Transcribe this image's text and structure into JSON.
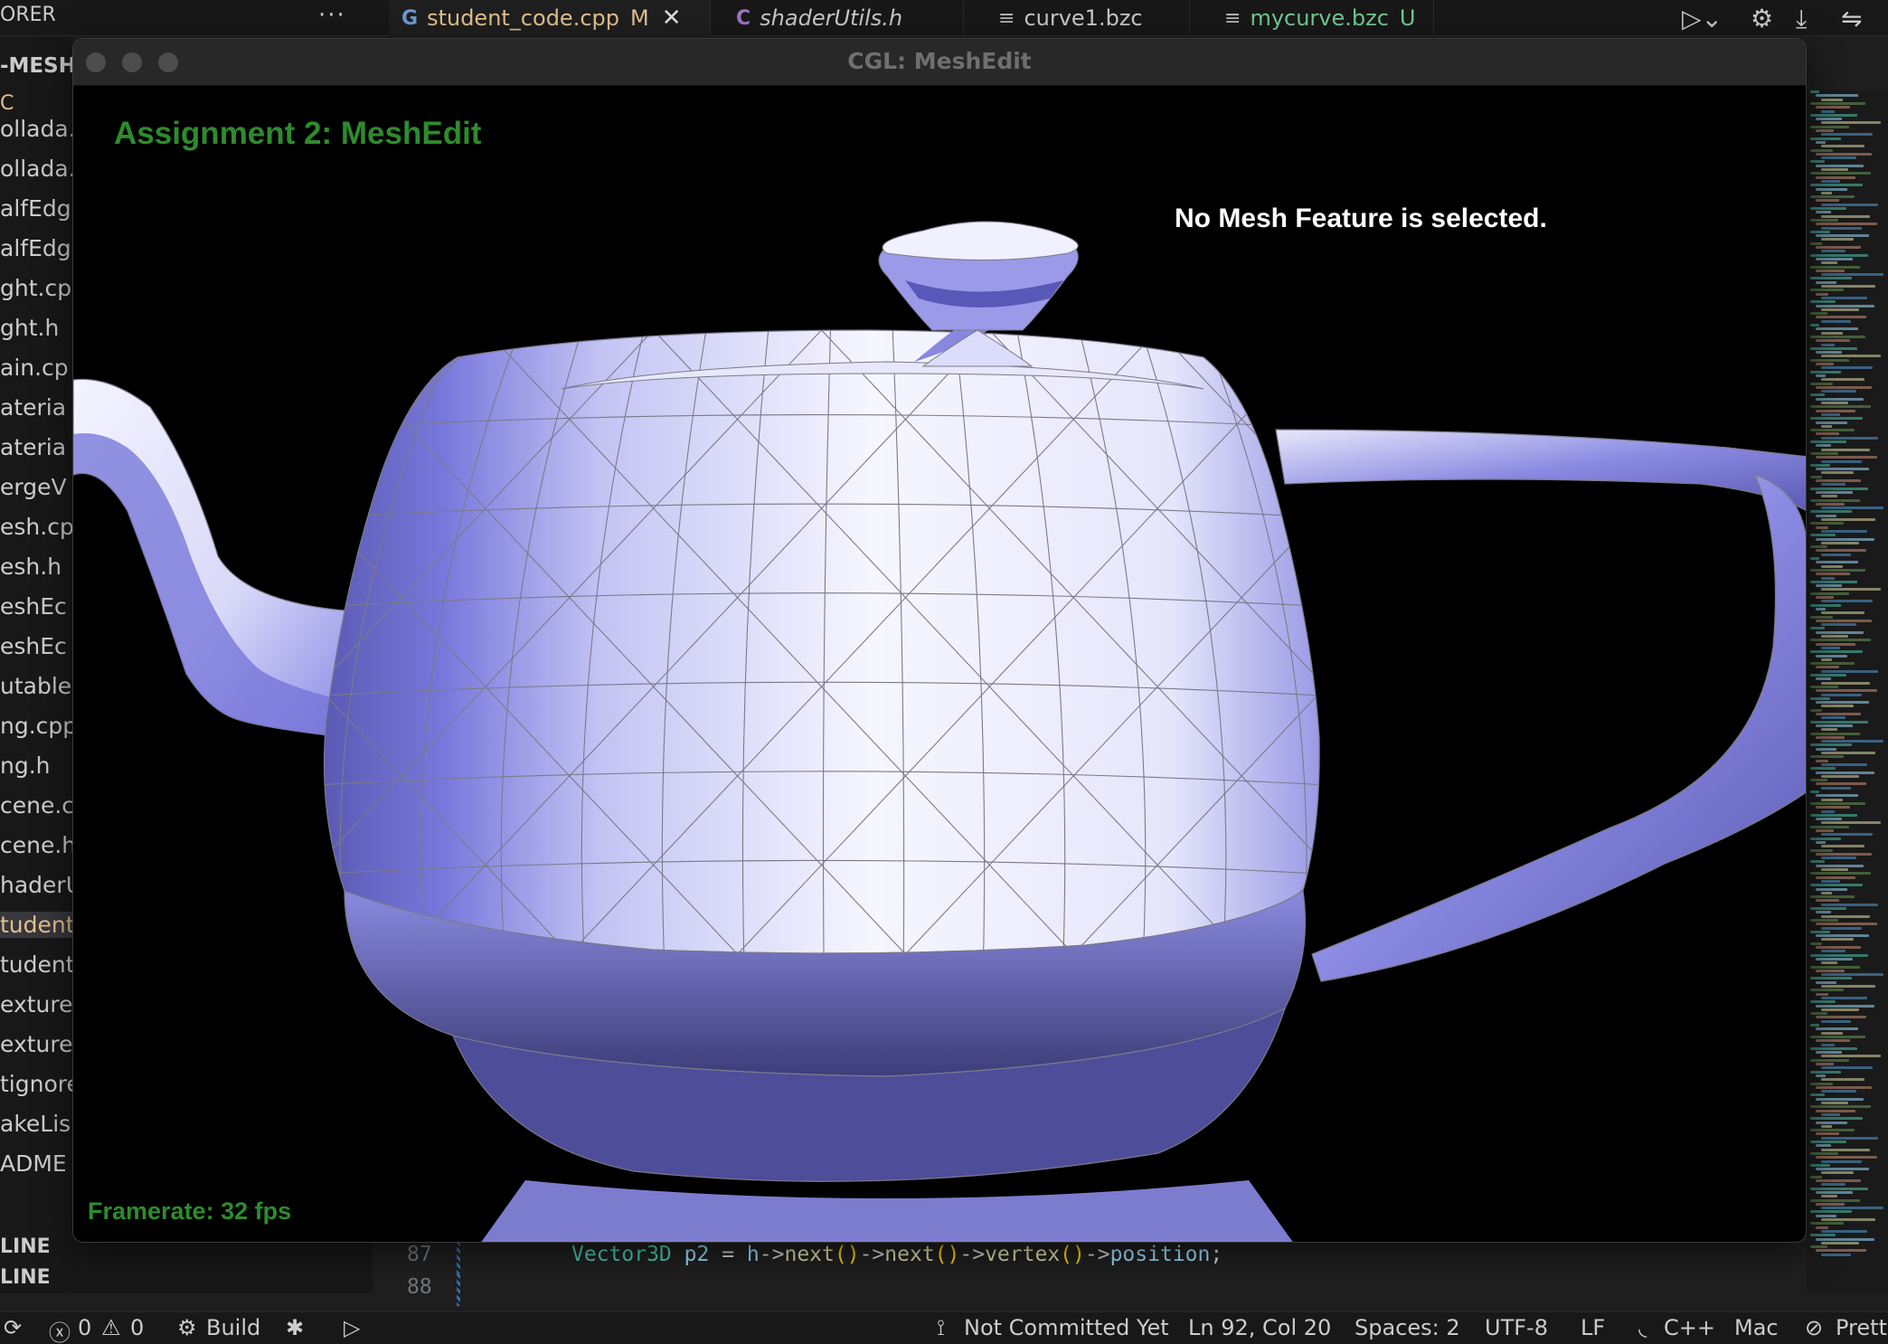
{
  "editor": {
    "explorer_title": "ORER",
    "explorer_more": "···",
    "tabs": [
      {
        "icon": "cpp-file-icon",
        "label": "student_code.cpp",
        "badge": "M",
        "active": true
      },
      {
        "icon": "c-header-file-icon",
        "label": "shaderUtils.h",
        "badge": "",
        "active": false
      },
      {
        "icon": "text-file-icon",
        "label": "curve1.bzc",
        "badge": "",
        "active": false
      },
      {
        "icon": "text-file-icon",
        "label": "mycurve.bzc",
        "badge": "U",
        "active": false
      }
    ],
    "sidebar": {
      "folder_label": "-MESHE",
      "folder_sub": "C",
      "files": [
        "ollada.",
        "ollada.",
        "alfEdg",
        "alfEdg",
        "ght.cp",
        "ght.h",
        "ain.cp",
        "ateria",
        "ateria",
        "ergeV",
        "esh.cp",
        "esh.h",
        "eshEc",
        "eshEc",
        "utable",
        "ng.cpp",
        "ng.h",
        "cene.c",
        "cene.h",
        "haderU",
        "tudent",
        "tudent",
        "exture.",
        "exture.",
        "tignore",
        "akeLis",
        "ADME"
      ],
      "selected_index": 20,
      "outline_1": "LINE",
      "outline_2": "LINE"
    },
    "line_numbers": [
      "87",
      "88"
    ],
    "code": {
      "type": "Vector3D",
      "var": "p2",
      "assign": "=",
      "obj": "h",
      "arrow": "->",
      "next1": "next",
      "next2": "next",
      "vertex": "vertex",
      "position": "position",
      "parens": "()",
      "semi": ";"
    },
    "status": {
      "errors": "0",
      "warnings": "0",
      "build": "Build",
      "git": "Not Committed Yet",
      "position": "Ln 92, Col 20",
      "spaces": "Spaces: 2",
      "encoding": "UTF-8",
      "eol": "LF",
      "language": "C++",
      "platform": "Mac",
      "formatter": "Prett"
    }
  },
  "window": {
    "title": "CGL: MeshEdit",
    "assignment_title": "Assignment 2: MeshEdit",
    "mesh_status": "No Mesh Feature is selected.",
    "framerate": "Framerate: 32 fps",
    "mesh_colors": {
      "light": "#f4f4ff",
      "mid": "#a9a9ee",
      "dark": "#5858b8",
      "edge": "#7a7a8a"
    }
  }
}
